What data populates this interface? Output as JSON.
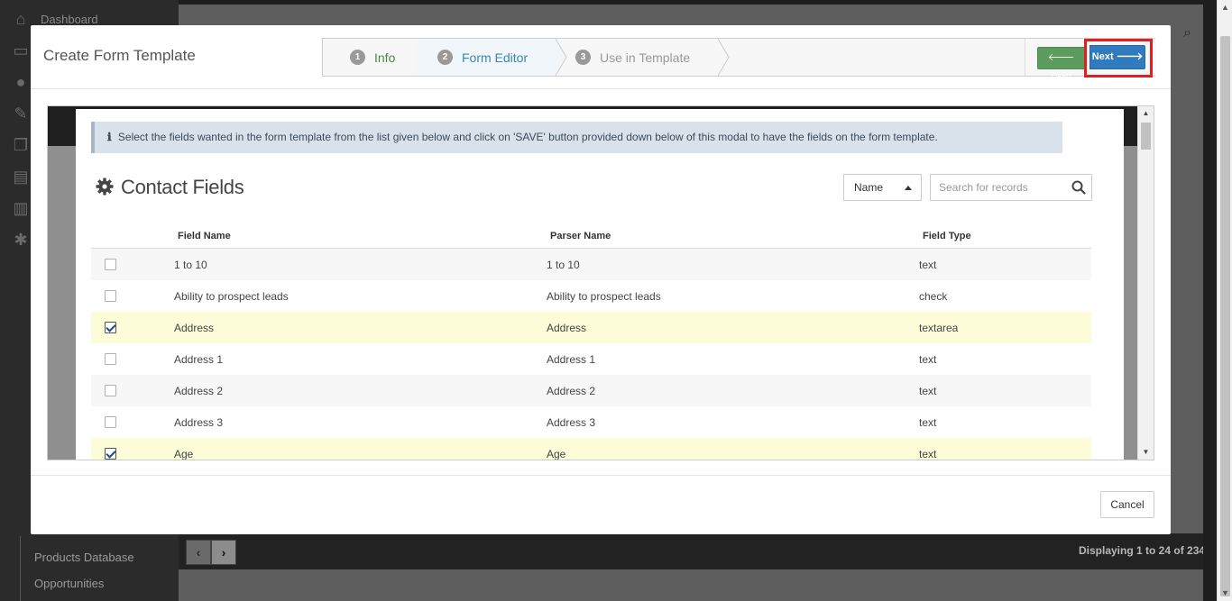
{
  "background": {
    "sidebar_top_item": "Dashboard",
    "sidebar_bottom_items": [
      "Products Database",
      "Opportunities"
    ],
    "icons": [
      "home-icon",
      "inbox-icon",
      "users-icon",
      "wrench-icon",
      "documents-icon",
      "file-icon",
      "chart-icon",
      "settings-icon"
    ],
    "pager_prev": "‹",
    "pager_next": "›",
    "displaying_text": "Displaying 1 to 24 of 234"
  },
  "modal": {
    "title": "Create Form Template",
    "wizard": {
      "steps": [
        {
          "num": "1",
          "label": "Info",
          "state": "complete"
        },
        {
          "num": "2",
          "label": "Form Editor",
          "state": "active"
        },
        {
          "num": "3",
          "label": "Use in Template",
          "state": "upcoming"
        }
      ],
      "prev_label": "Prev",
      "next_label": "Next"
    },
    "info_message": "Select the fields wanted in the form template from the list given below and click on 'SAVE' button provided down below of this modal to have the fields on the form template.",
    "section_title": "Contact Fields",
    "sort_select_value": "Name",
    "search_placeholder": "Search for records",
    "table": {
      "headers": [
        "Field Name",
        "Parser Name",
        "Field Type"
      ],
      "rows": [
        {
          "checked": false,
          "field_name": "1 to 10",
          "parser_name": "1 to 10",
          "field_type": "text"
        },
        {
          "checked": false,
          "field_name": "Ability to prospect leads",
          "parser_name": "Ability to prospect leads",
          "field_type": "check"
        },
        {
          "checked": true,
          "field_name": "Address",
          "parser_name": "Address",
          "field_type": "textarea"
        },
        {
          "checked": false,
          "field_name": "Address 1",
          "parser_name": "Address 1",
          "field_type": "text"
        },
        {
          "checked": false,
          "field_name": "Address 2",
          "parser_name": "Address 2",
          "field_type": "text"
        },
        {
          "checked": false,
          "field_name": "Address 3",
          "parser_name": "Address 3",
          "field_type": "text"
        },
        {
          "checked": true,
          "field_name": "Age",
          "parser_name": "Age",
          "field_type": "text"
        }
      ]
    },
    "cancel_label": "Cancel"
  },
  "colors": {
    "primary": "#2f7bbd",
    "success": "#5c9c5c",
    "highlight_border": "#e02020",
    "selected_row": "#fcfcd8"
  }
}
